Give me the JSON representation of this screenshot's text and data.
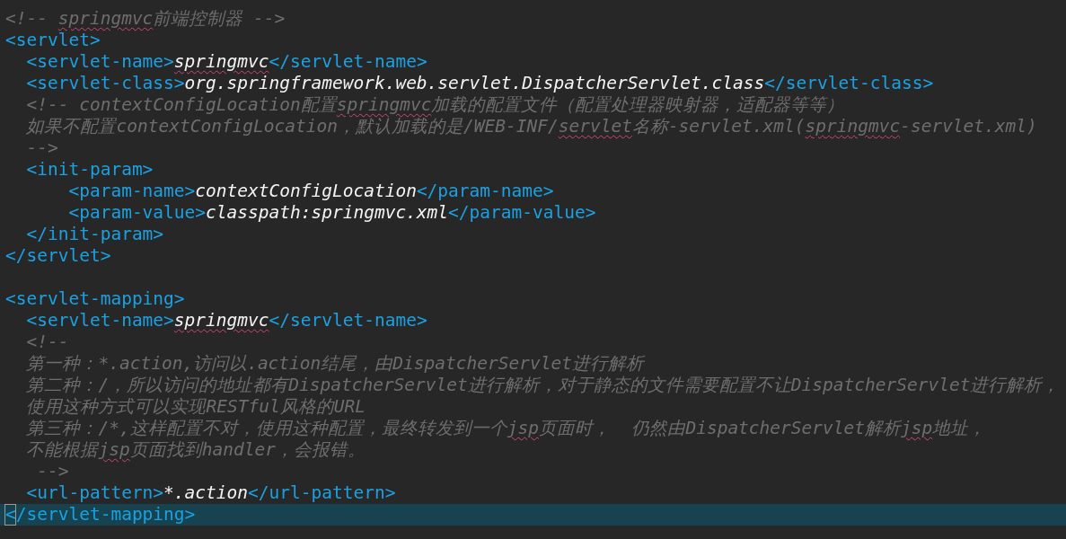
{
  "blocks": [
    {
      "lines": [
        {
          "tokens": [
            {
              "kind": "comment",
              "text": "<!-- "
            },
            {
              "kind": "comment",
              "text": "springmvc",
              "misspelled": true
            },
            {
              "kind": "comment",
              "text": "前端控制器 -->"
            }
          ]
        },
        {
          "tokens": [
            {
              "kind": "tag",
              "text": "<servlet>"
            }
          ]
        },
        {
          "tokens": [
            {
              "kind": "tag",
              "text": "  <servlet-name>"
            },
            {
              "kind": "value",
              "text": "springmvc",
              "misspelled": true
            },
            {
              "kind": "tag",
              "text": "</servlet-name>"
            }
          ]
        },
        {
          "tokens": [
            {
              "kind": "tag",
              "text": "  <servlet-class>"
            },
            {
              "kind": "value",
              "text": "org.springframework.web.servlet.DispatcherServlet.class"
            },
            {
              "kind": "tag",
              "text": "</servlet-class>"
            }
          ]
        },
        {
          "tokens": [
            {
              "kind": "comment",
              "text": "  <!-- contextConfigLocation配置"
            },
            {
              "kind": "comment",
              "text": "springmvc",
              "misspelled": true
            },
            {
              "kind": "comment",
              "text": "加载的配置文件（配置处理器映射器，适配器等等）"
            }
          ]
        },
        {
          "tokens": [
            {
              "kind": "comment",
              "text": "  如果不配置contextConfigLocation，默认加载的是/WEB-INF/"
            },
            {
              "kind": "comment",
              "text": "servlet",
              "misspelled": true
            },
            {
              "kind": "comment",
              "text": "名称-servlet.xml("
            },
            {
              "kind": "comment",
              "text": "springmvc",
              "misspelled": true
            },
            {
              "kind": "comment",
              "text": "-servlet.xml)"
            }
          ]
        },
        {
          "tokens": [
            {
              "kind": "comment",
              "text": "  -->"
            }
          ]
        },
        {
          "tokens": [
            {
              "kind": "tag",
              "text": "  <init-param>"
            }
          ]
        },
        {
          "tokens": [
            {
              "kind": "tag",
              "text": "      <param-name>"
            },
            {
              "kind": "value",
              "text": "contextConfigLocation"
            },
            {
              "kind": "tag",
              "text": "</param-name>"
            }
          ]
        },
        {
          "tokens": [
            {
              "kind": "tag",
              "text": "      <param-value>"
            },
            {
              "kind": "value",
              "text": "classpath:springmvc.xml"
            },
            {
              "kind": "tag",
              "text": "</param-value>"
            }
          ]
        },
        {
          "tokens": [
            {
              "kind": "tag",
              "text": "  </init-param>"
            }
          ]
        },
        {
          "tokens": [
            {
              "kind": "tag",
              "text": "</servlet>"
            }
          ]
        }
      ]
    },
    {
      "lines": [
        {
          "tokens": [
            {
              "kind": "tag",
              "text": "<servlet-mapping>"
            }
          ]
        },
        {
          "tokens": [
            {
              "kind": "tag",
              "text": "  <servlet-name>"
            },
            {
              "kind": "value",
              "text": "springmvc",
              "misspelled": true
            },
            {
              "kind": "tag",
              "text": "</servlet-name>"
            }
          ]
        },
        {
          "tokens": [
            {
              "kind": "comment",
              "text": "  <!--"
            }
          ]
        },
        {
          "tokens": [
            {
              "kind": "comment",
              "text": "  第一种：*.action,访问以.action结尾，由DispatcherServlet进行解析"
            }
          ]
        },
        {
          "tokens": [
            {
              "kind": "comment",
              "text": "  第二种：/，所以访问的地址都有DispatcherServlet进行解析，对于静态的文件需要配置不让DispatcherServlet进行解析，"
            }
          ]
        },
        {
          "tokens": [
            {
              "kind": "comment",
              "text": "  使用这种方式可以实现RESTful风格的URL"
            }
          ]
        },
        {
          "tokens": [
            {
              "kind": "comment",
              "text": "  第三种：/*,这样配置不对，使用这种配置，最终转发到一个"
            },
            {
              "kind": "comment",
              "text": "jsp",
              "misspelled": true
            },
            {
              "kind": "comment",
              "text": "页面时，  仍然由DispatcherServlet解析"
            },
            {
              "kind": "comment",
              "text": "jsp",
              "misspelled": true
            },
            {
              "kind": "comment",
              "text": "地址，"
            }
          ]
        },
        {
          "tokens": [
            {
              "kind": "comment",
              "text": "  不能根据"
            },
            {
              "kind": "comment",
              "text": "jsp",
              "misspelled": true
            },
            {
              "kind": "comment",
              "text": "页面找到handler，会报错。"
            }
          ]
        },
        {
          "tokens": [
            {
              "kind": "comment",
              "text": "   -->"
            }
          ]
        },
        {
          "tokens": [
            {
              "kind": "tag",
              "text": "  <url-pattern>"
            },
            {
              "kind": "value",
              "text": "*.action"
            },
            {
              "kind": "tag",
              "text": "</url-pattern>"
            }
          ]
        },
        {
          "current": true,
          "cursor": true,
          "tokens": [
            {
              "kind": "tag",
              "text": "</servlet-mapping>"
            }
          ]
        }
      ]
    }
  ]
}
